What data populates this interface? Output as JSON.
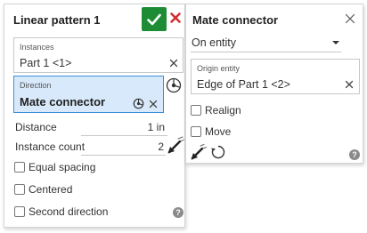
{
  "linear_pattern": {
    "title": "Linear pattern 1",
    "instances_label": "Instances",
    "instances_value": "Part 1 <1>",
    "direction_label": "Direction",
    "direction_value": "Mate connector",
    "distance_label": "Distance",
    "distance_value": "1 in",
    "instance_count_label": "Instance count",
    "instance_count_value": "2",
    "equal_spacing_label": "Equal spacing",
    "centered_label": "Centered",
    "second_direction_label": "Second direction",
    "help_glyph": "?"
  },
  "mate_connector": {
    "title": "Mate connector",
    "on_entity_value": "On entity",
    "origin_entity_label": "Origin entity",
    "origin_entity_value": "Edge of Part 1 <2>",
    "realign_label": "Realign",
    "move_label": "Move",
    "help_glyph": "?"
  },
  "colors": {
    "accept_green": "#1e8c35",
    "reject_red": "#d32f2f",
    "active_field_bg": "#d7e9fa",
    "active_field_border": "#3c8fd8"
  },
  "icons": [
    "check-icon",
    "close-icon",
    "clear-icon",
    "mate-connector-icon",
    "direction-flip-arrow-icon",
    "cycle-icon",
    "help-icon",
    "caret-down-icon"
  ]
}
